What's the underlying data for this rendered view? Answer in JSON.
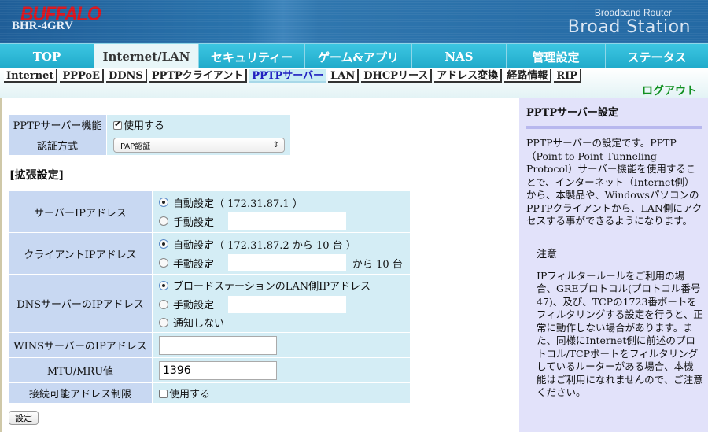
{
  "header": {
    "brand": "BUFFALO",
    "model": "BHR-4GRV",
    "product_sub": "Broadband Router",
    "product": "Broad Station"
  },
  "nav": [
    {
      "label": "TOP"
    },
    {
      "label": "Internet/LAN",
      "active": true
    },
    {
      "label": "セキュリティー"
    },
    {
      "label": "ゲーム&アプリ"
    },
    {
      "label": "NAS"
    },
    {
      "label": "管理設定"
    },
    {
      "label": "ステータス"
    }
  ],
  "subnav": [
    {
      "label": "Internet"
    },
    {
      "label": "PPPoE"
    },
    {
      "label": "DDNS"
    },
    {
      "label": "PPTPクライアント"
    },
    {
      "label": "PPTPサーバー",
      "active": true
    },
    {
      "label": "LAN"
    },
    {
      "label": "DHCPリース"
    },
    {
      "label": "アドレス変換"
    },
    {
      "label": "経路情報"
    },
    {
      "label": "RIP"
    }
  ],
  "logout": "ログアウト",
  "basic": {
    "pptp_label": "PPTPサーバー機能",
    "pptp_enable": "使用する",
    "auth_label": "認証方式",
    "auth_value": "PAP認証"
  },
  "ext_title": "[拡張設定]",
  "ext": {
    "server_ip": {
      "label": "サーバーIPアドレス",
      "auto": "自動設定（ 172.31.87.1 ）",
      "manual": "手動設定",
      "value": ""
    },
    "client_ip": {
      "label": "クライアントIPアドレス",
      "auto": "自動設定（ 172.31.87.2 から 10 台 ）",
      "manual": "手動設定",
      "value": "",
      "suffix": "から 10 台"
    },
    "dns": {
      "label": "DNSサーバーのIPアドレス",
      "opt1": "ブロードステーションのLAN側IPアドレス",
      "opt2": "手動設定",
      "opt3": "通知しない",
      "value": ""
    },
    "wins": {
      "label": "WINSサーバーのIPアドレス",
      "value": ""
    },
    "mtu": {
      "label": "MTU/MRU値",
      "value": "1396"
    },
    "restrict": {
      "label": "接続可能アドレス制限",
      "check": "使用する"
    }
  },
  "submit": "設定",
  "help": {
    "title": "PPTPサーバー設定",
    "body": "PPTPサーバーの設定です。PPTP（Point to Point Tunneling Protocol）サーバー機能を使用することで、インターネット（Internet側）から、本製品や、WindowsパソコンのPPTPクライアントから、LAN側にアクセスする事ができるようになります。",
    "note_title": "注意",
    "note": "IPフィルタールールをご利用の場合、GREプロトコル(プロトコル番号47)、及び、TCPの1723番ポートをフィルタリングする設定を行うと、正常に動作しない場合があります。また、同様にInternet側に前述のプロトコル/TCPポートをフィルタリングしているルーターがある場合、本機能はご利用になれませんので、ご注意ください。"
  }
}
